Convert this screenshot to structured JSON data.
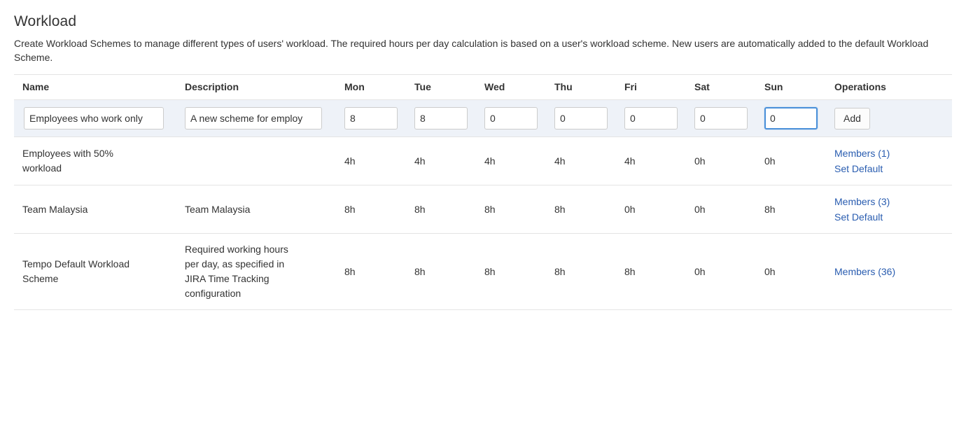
{
  "page": {
    "title": "Workload",
    "description": "Create Workload Schemes to manage different types of users' workload. The required hours per day calculation is based on a user's workload scheme. New users are automatically added to the default Workload Scheme."
  },
  "table": {
    "columns": [
      "Name",
      "Description",
      "Mon",
      "Tue",
      "Wed",
      "Thu",
      "Fri",
      "Sat",
      "Sun",
      "Operations"
    ],
    "new_row": {
      "name_value": "Employees who work only",
      "name_placeholder": "",
      "description_value": "A new scheme for employ",
      "description_placeholder": "",
      "mon": "8",
      "tue": "8",
      "wed": "0",
      "thu": "0",
      "fri": "0",
      "sat": "0",
      "sun": "0",
      "focused_field": "sun",
      "add_label": "Add"
    },
    "rows": [
      {
        "name": "Employees with 50% workload",
        "description": "",
        "mon": "4h",
        "tue": "4h",
        "wed": "4h",
        "thu": "4h",
        "fri": "4h",
        "sat": "0h",
        "sun": "0h",
        "operations": [
          "Members (1)",
          "Set Default"
        ]
      },
      {
        "name": "Team Malaysia",
        "description": "Team Malaysia",
        "mon": "8h",
        "tue": "8h",
        "wed": "8h",
        "thu": "8h",
        "fri": "0h",
        "sat": "0h",
        "sun": "8h",
        "operations": [
          "Members (3)",
          "Set Default"
        ]
      },
      {
        "name": "Tempo Default Workload Scheme",
        "description": "Required working hours per day, as specified in JIRA Time Tracking configuration",
        "mon": "8h",
        "tue": "8h",
        "wed": "8h",
        "thu": "8h",
        "fri": "8h",
        "sat": "0h",
        "sun": "0h",
        "operations": [
          "Members (36)"
        ]
      }
    ]
  },
  "colors": {
    "link": "#2a5db0",
    "form_row_bg": "#eef2f8",
    "focus_border": "#4a90d9",
    "border": "#e4e4e4",
    "text": "#333333"
  }
}
